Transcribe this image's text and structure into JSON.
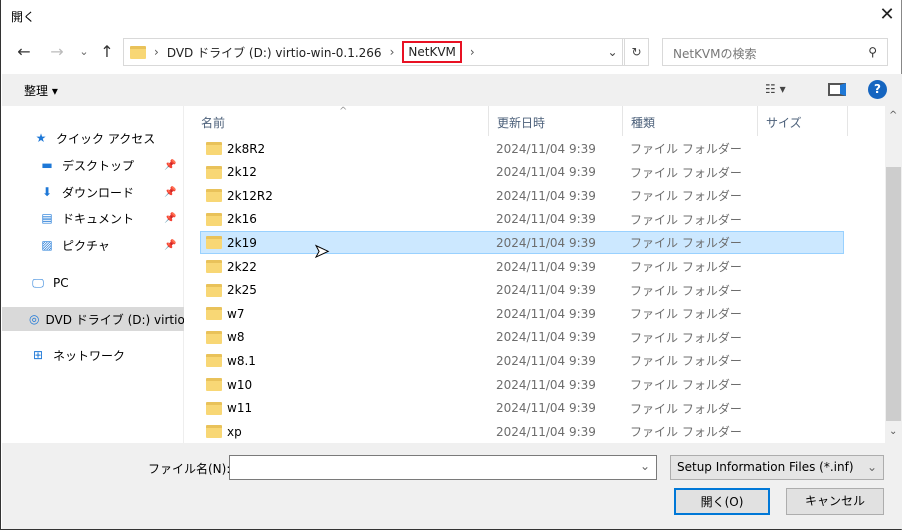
{
  "window": {
    "title": "開く",
    "close": "✕"
  },
  "nav": {
    "back": "←",
    "forward": "→",
    "recent": "⌄",
    "up": "↑"
  },
  "address": {
    "crumbs": [
      "DVD ドライブ (D:) virtio-win-0.1.266",
      "NetKVM"
    ],
    "dropdown": "⌄",
    "refresh": "↻"
  },
  "search": {
    "placeholder": "NetKVMの検索",
    "icon": "⚲"
  },
  "toolbar": {
    "organize": "整理 ▾",
    "view": "☷ ▾",
    "help": "?"
  },
  "sidebar": {
    "items": [
      {
        "label": "クイック アクセス",
        "icon": "★"
      },
      {
        "label": "デスクトップ",
        "icon": "▬",
        "pinned": true
      },
      {
        "label": "ダウンロード",
        "icon": "⬇",
        "pinned": true
      },
      {
        "label": "ドキュメント",
        "icon": "▤",
        "pinned": true
      },
      {
        "label": "ピクチャ",
        "icon": "▨",
        "pinned": true
      },
      {
        "label": "PC",
        "icon": "🖵"
      },
      {
        "label": "DVD ドライブ (D:) virtio",
        "icon": "◎"
      },
      {
        "label": "ネットワーク",
        "icon": "⊞"
      }
    ],
    "pin": "📌"
  },
  "columns": [
    "名前",
    "更新日時",
    "種類",
    "サイズ"
  ],
  "files": [
    {
      "name": "2k8R2",
      "date": "2024/11/04 9:39",
      "type": "ファイル フォルダー"
    },
    {
      "name": "2k12",
      "date": "2024/11/04 9:39",
      "type": "ファイル フォルダー"
    },
    {
      "name": "2k12R2",
      "date": "2024/11/04 9:39",
      "type": "ファイル フォルダー"
    },
    {
      "name": "2k16",
      "date": "2024/11/04 9:39",
      "type": "ファイル フォルダー"
    },
    {
      "name": "2k19",
      "date": "2024/11/04 9:39",
      "type": "ファイル フォルダー",
      "selected": true
    },
    {
      "name": "2k22",
      "date": "2024/11/04 9:39",
      "type": "ファイル フォルダー"
    },
    {
      "name": "2k25",
      "date": "2024/11/04 9:39",
      "type": "ファイル フォルダー"
    },
    {
      "name": "w7",
      "date": "2024/11/04 9:39",
      "type": "ファイル フォルダー"
    },
    {
      "name": "w8",
      "date": "2024/11/04 9:39",
      "type": "ファイル フォルダー"
    },
    {
      "name": "w8.1",
      "date": "2024/11/04 9:39",
      "type": "ファイル フォルダー"
    },
    {
      "name": "w10",
      "date": "2024/11/04 9:39",
      "type": "ファイル フォルダー"
    },
    {
      "name": "w11",
      "date": "2024/11/04 9:39",
      "type": "ファイル フォルダー"
    },
    {
      "name": "xp",
      "date": "2024/11/04 9:39",
      "type": "ファイル フォルダー"
    }
  ],
  "footer": {
    "filename_label": "ファイル名(N):",
    "filename_value": "",
    "filter": "Setup Information Files (*.inf)",
    "open": "開く(O)",
    "cancel": "キャンセル"
  }
}
